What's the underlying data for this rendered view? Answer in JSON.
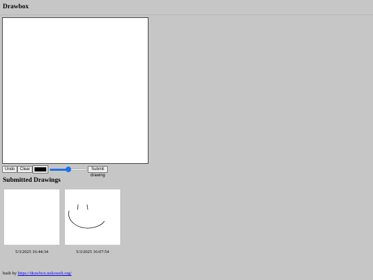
{
  "app": {
    "title": "Drawbox"
  },
  "toolbar": {
    "undo_label": "Undo",
    "clear_label": "Clear",
    "color_value": "#000000",
    "brush_size_fraction": 0.5,
    "submit_label": "Submit drawing"
  },
  "gallery": {
    "heading": "Submitted Drawings",
    "items": [
      {
        "timestamp": "5/3/2025 16:44:34"
      },
      {
        "timestamp": "5/3/2025 16:07:54"
      }
    ]
  },
  "footer": {
    "prefix": "built by",
    "link_text": "https://drawbox.nekoweb.org/"
  },
  "colors": {
    "background": "#c6c6c6",
    "accent": "#1a73e8"
  }
}
